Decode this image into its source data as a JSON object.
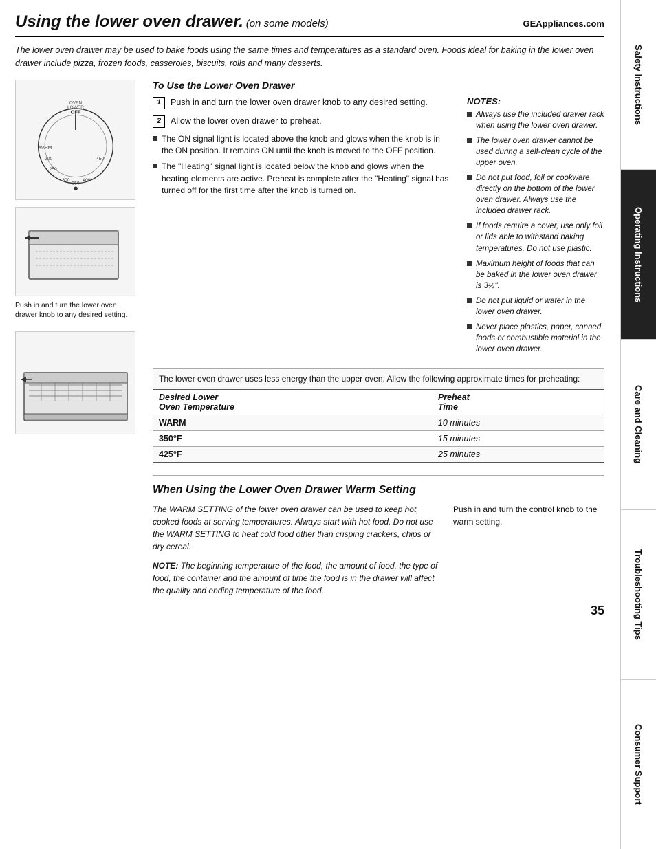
{
  "header": {
    "title": "Using the lower oven drawer.",
    "subtitle": "(on some models)",
    "website": "GEAppliances.com"
  },
  "intro": "The lower oven drawer may be used to bake foods using the same times and temperatures as a standard oven. Foods ideal for baking in the lower oven drawer include pizza, frozen foods, casseroles, biscuits, rolls and many desserts.",
  "section1": {
    "title": "To Use the Lower Oven Drawer",
    "steps": [
      {
        "num": "1",
        "text": "Push in and turn the lower oven drawer knob to any desired setting."
      },
      {
        "num": "2",
        "text": "Allow the lower oven drawer to preheat."
      }
    ],
    "bullets": [
      "The ON signal light is located above the knob and glows when the knob is in the ON position. It remains ON until the knob is moved to the OFF position.",
      "The \"Heating\" signal light is located below the knob and glows when the heating elements are active. Preheat is complete after the \"Heating\" signal has turned off for the first time after the knob is turned on."
    ]
  },
  "notes": {
    "title": "NOTES:",
    "items": [
      "Always use the included drawer rack when using the lower oven drawer.",
      "The lower oven drawer cannot be used during a self-clean cycle of the upper oven.",
      "Do not put food, foil or cookware directly on the bottom of the lower oven drawer. Always use the included drawer rack.",
      "If foods require a cover, use only foil or lids able to withstand baking temperatures. Do not use plastic.",
      "Maximum height of foods that can be baked in the lower oven drawer is 3½\".",
      "Do not put liquid or water in the lower oven drawer.",
      "Never place plastics, paper, canned foods or combustible material in the lower oven drawer."
    ]
  },
  "diagram_caption": "Push in and turn the lower oven drawer knob to any desired setting.",
  "preheat_table": {
    "intro": "The lower oven drawer uses less energy than the upper oven. Allow the following approximate times for preheating:",
    "col1": "Desired Lower Oven Temperature",
    "col2": "Preheat Time",
    "rows": [
      {
        "temp": "WARM",
        "time": "10 minutes"
      },
      {
        "temp": "350°F",
        "time": "15 minutes"
      },
      {
        "temp": "425°F",
        "time": "25 minutes"
      }
    ]
  },
  "warm_section": {
    "title": "When Using the Lower Oven Drawer Warm Setting",
    "left_text": "The WARM SETTING of the lower oven drawer can be used to keep hot, cooked foods at serving temperatures. Always start with hot food. Do not use the WARM SETTING to heat cold food other than crisping crackers, chips or dry cereal.",
    "left_note": "NOTE: The beginning temperature of the food, the amount of food, the type of food, the container and the amount of time the food is in the drawer will affect the quality and ending temperature of the food.",
    "right_text": "Push in and turn the control knob to the warm setting."
  },
  "sidebar": {
    "tabs": [
      {
        "label": "Safety Instructions",
        "active": false
      },
      {
        "label": "Operating Instructions",
        "active": true
      },
      {
        "label": "Care and Cleaning",
        "active": false
      },
      {
        "label": "Troubleshooting Tips",
        "active": false
      },
      {
        "label": "Consumer Support",
        "active": false
      }
    ]
  },
  "page_number": "35"
}
